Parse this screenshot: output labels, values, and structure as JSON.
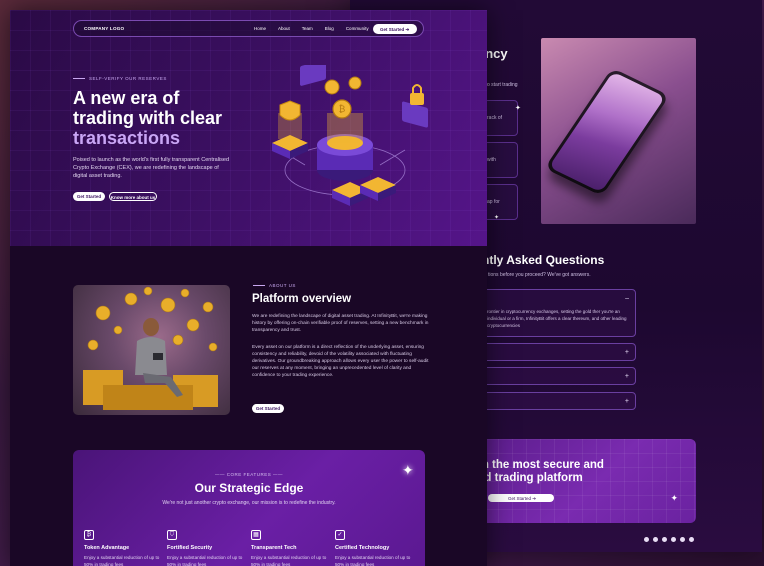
{
  "nav": {
    "logo": "COMPANY LOGO",
    "links": [
      "Home",
      "About",
      "Team",
      "Blog",
      "Community"
    ],
    "cta": "Get Started  ➔"
  },
  "hero": {
    "eyebrow": "SELF-VERIFY OUR RESERVES",
    "title_line1": "A new era of",
    "title_line2": "trading with clear",
    "title_line3": "transactions",
    "description": "Poised to launch as the world's first fully transparent Centralised Crypto Exchange (CEX), we are redefining the landscape of digital asset trading.",
    "btn_primary": "Get Started",
    "btn_secondary": "Know more about us"
  },
  "about": {
    "eyebrow": "ABOUT US",
    "title": "Platform overview",
    "p1": "We are redefining the landscape of digital asset trading. At InfinityBit, we're making history by offering on-chain verifiable proof of reserves, setting a new benchmark in transparency and trust.",
    "p2": "Every asset on our platform is a direct reflection of the underlying asset, ensuring consistency and reliability, devoid of the volatility associated with fluctuating derivatives. Our groundbreaking approach allows every user the power to self-audit our reserves at any moment, bringing an unprecedented level of clarity and confidence to your trading experience.",
    "btn": "Get Started"
  },
  "strategic": {
    "eyebrow": "CORE FEATURES",
    "title": "Our Strategic Edge",
    "subtitle": "We're not just another crypto exchange, our mission is to redefine the industry.",
    "features": [
      {
        "title": "Token Advantage",
        "desc": "Enjoy a substantial reduction of up to 50% in trading fees",
        "icon": "token-icon"
      },
      {
        "title": "Fortified Security",
        "desc": "Enjoy a substantial reduction of up to 50% in trading fees",
        "icon": "shield-icon"
      },
      {
        "title": "Transparent Tech",
        "desc": "Enjoy a substantial reduction of up to 50% in trading fees",
        "icon": "chip-icon"
      },
      {
        "title": "Certified Technology",
        "desc": "Enjoy a substantial reduction of up to 50% in trading fees",
        "icon": "certificate-icon"
      }
    ]
  },
  "back": {
    "heading_fragment": "ency",
    "sub_fragment": "o start trading",
    "card_fragments": [
      "rack of",
      "with",
      "ap for"
    ],
    "faq_title": "ntly Asked Questions",
    "faq_sub": "tions before you proceed? We've got answers.",
    "faq_answer": "rontier in cryptocurrency exchanges, setting the gold ther you're an individual or a firm, InfinityBit offers a clear thereum, and other leading cryptocurrencies",
    "faq_open_sign": "–",
    "faq_closed_sign": "+",
    "cta_line1": "th the most secure and",
    "cta_line2": "ed trading platform",
    "cta_btn": "Get Started  ➔",
    "socials": [
      "facebook-icon",
      "instagram-icon",
      "twitter-icon",
      "youtube-icon",
      "linkedin-icon",
      "tiktok-icon"
    ]
  },
  "colors": {
    "accent": "#c9a6f5",
    "bg": "#1a0726",
    "gold": "#f2b632",
    "purple": "#6a1fa5"
  }
}
